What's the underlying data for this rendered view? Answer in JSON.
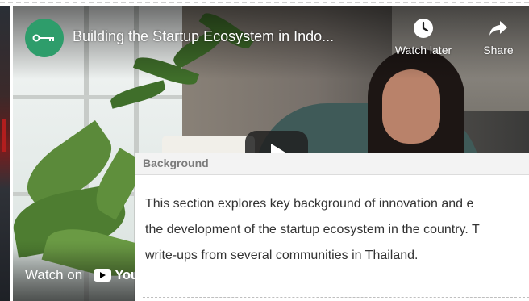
{
  "video": {
    "title": "Building the Startup Ecosystem in Indo...",
    "watch_later_label": "Watch later",
    "share_label": "Share",
    "watch_on_label": "Watch on",
    "youtube_wordmark": "YouTube",
    "avatar_color": "#2e9d6b"
  },
  "panel": {
    "title": "Background",
    "lines": [
      "This section explores key background of innovation and e",
      "the development of the startup ecosystem in the country. T",
      "write-ups from several communities in Thailand."
    ]
  },
  "icons": [
    "channel-logo-icon",
    "clock-icon",
    "share-arrow-icon",
    "play-icon",
    "youtube-logo-icon"
  ]
}
